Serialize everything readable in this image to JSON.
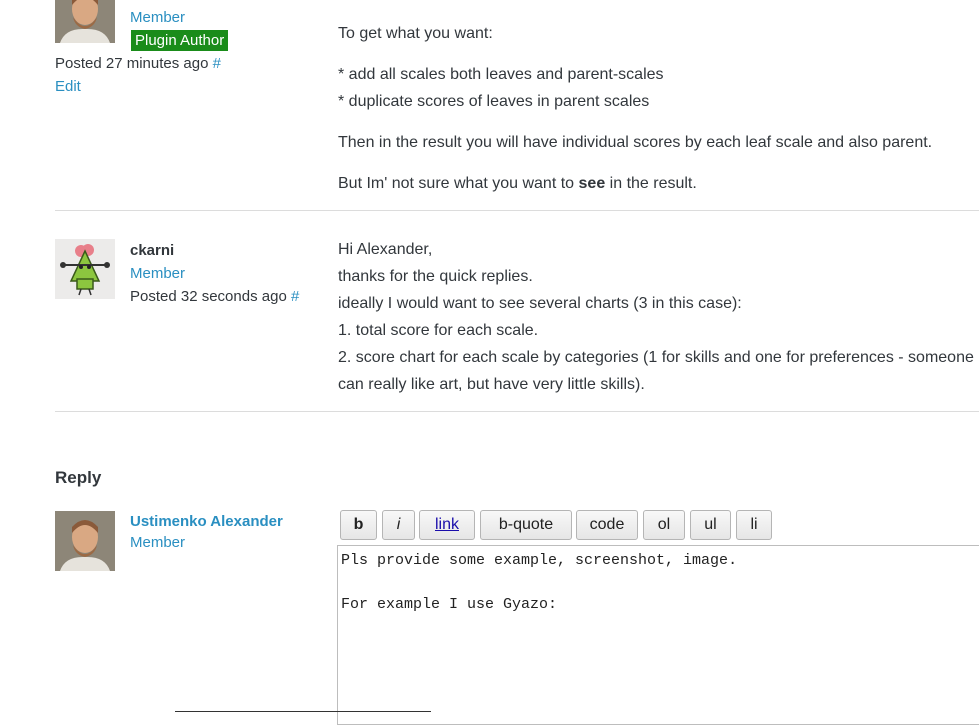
{
  "post1": {
    "role": "Member",
    "badge": "Plugin Author",
    "posted": "Posted 27 minutes ago",
    "hash": "#",
    "edit": "Edit",
    "lines": [
      "To get what you want:",
      "* add all scales both leaves and parent-scales",
      "* duplicate scores of leaves in parent scales",
      "Then in the result you will have individual scores by each leaf scale and also parent."
    ],
    "last_pre": "But Im' not sure what you want to ",
    "last_bold": "see",
    "last_post": " in the result."
  },
  "post2": {
    "author": "ckarni",
    "role": "Member",
    "posted": "Posted 32 seconds ago",
    "hash": "#",
    "lines": [
      "Hi Alexander,",
      "thanks for the quick replies.",
      "ideally I would want to see several charts (3 in this case):",
      "1. total score for each scale.",
      "2. score chart for each scale by categories (1 for skills and one for preferences - someone",
      "can really like art, but have very little skills)."
    ]
  },
  "reply": {
    "heading": "Reply",
    "author": "Ustimenko Alexander",
    "role": "Member",
    "toolbar": [
      "b",
      "i",
      "link",
      "b-quote",
      "code",
      "ol",
      "ul",
      "li"
    ],
    "editor_line1": "Pls provide some example, screenshot, image.",
    "editor_line2": "For example I use Gyazo:"
  }
}
